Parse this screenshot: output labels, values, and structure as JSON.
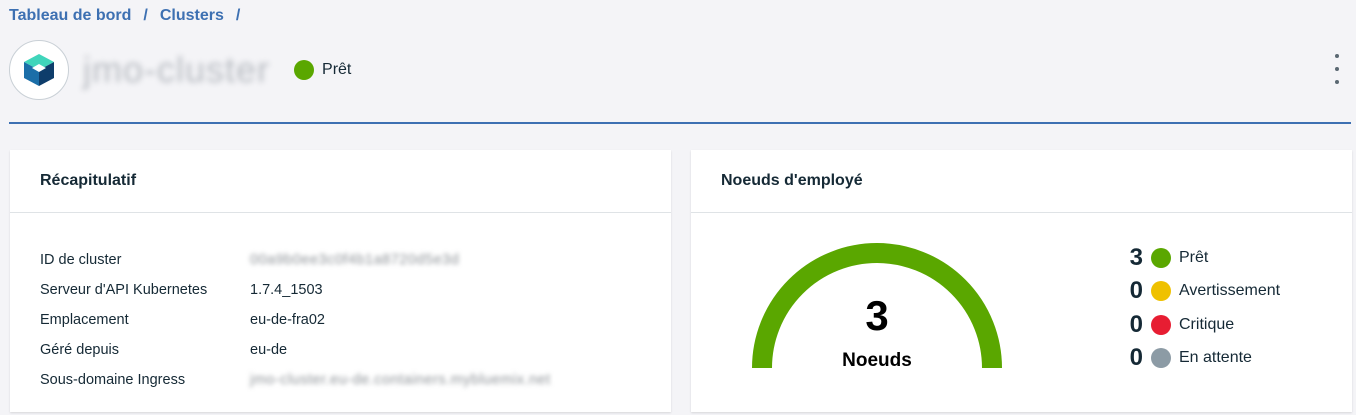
{
  "breadcrumb": {
    "items": [
      "Tableau de bord",
      "Clusters"
    ],
    "separator": "/"
  },
  "header": {
    "cluster_name": "jmo-cluster",
    "status_label": "Prêt",
    "status_color": "#5aa700",
    "menu_icon": "overflow-menu-vertical-icon",
    "logo_icon": "kubernetes-service-cube-icon"
  },
  "summary": {
    "title": "Récapitulatif",
    "rows": [
      {
        "key": "ID de cluster",
        "value": "00a9b0ee3c0f4b1a8720d5e3d"
      },
      {
        "key": "Serveur d'API Kubernetes",
        "value": "1.7.4_1503"
      },
      {
        "key": "Emplacement",
        "value": "eu-de-fra02"
      },
      {
        "key": "Géré depuis",
        "value": "eu-de"
      },
      {
        "key": "Sous-domaine Ingress",
        "value": "jmo-cluster.eu-de.containers.mybluemix.net"
      }
    ]
  },
  "workers": {
    "title": "Noeuds d'employé",
    "total": "3",
    "total_label": "Noeuds",
    "gauge_color": "#5aa700",
    "legend": [
      {
        "count": "3",
        "label": "Prêt",
        "color": "#5aa700"
      },
      {
        "count": "0",
        "label": "Avertissement",
        "color": "#efc100"
      },
      {
        "count": "0",
        "label": "Critique",
        "color": "#e71d32"
      },
      {
        "count": "0",
        "label": "En attente",
        "color": "#8c9ba5"
      }
    ]
  }
}
